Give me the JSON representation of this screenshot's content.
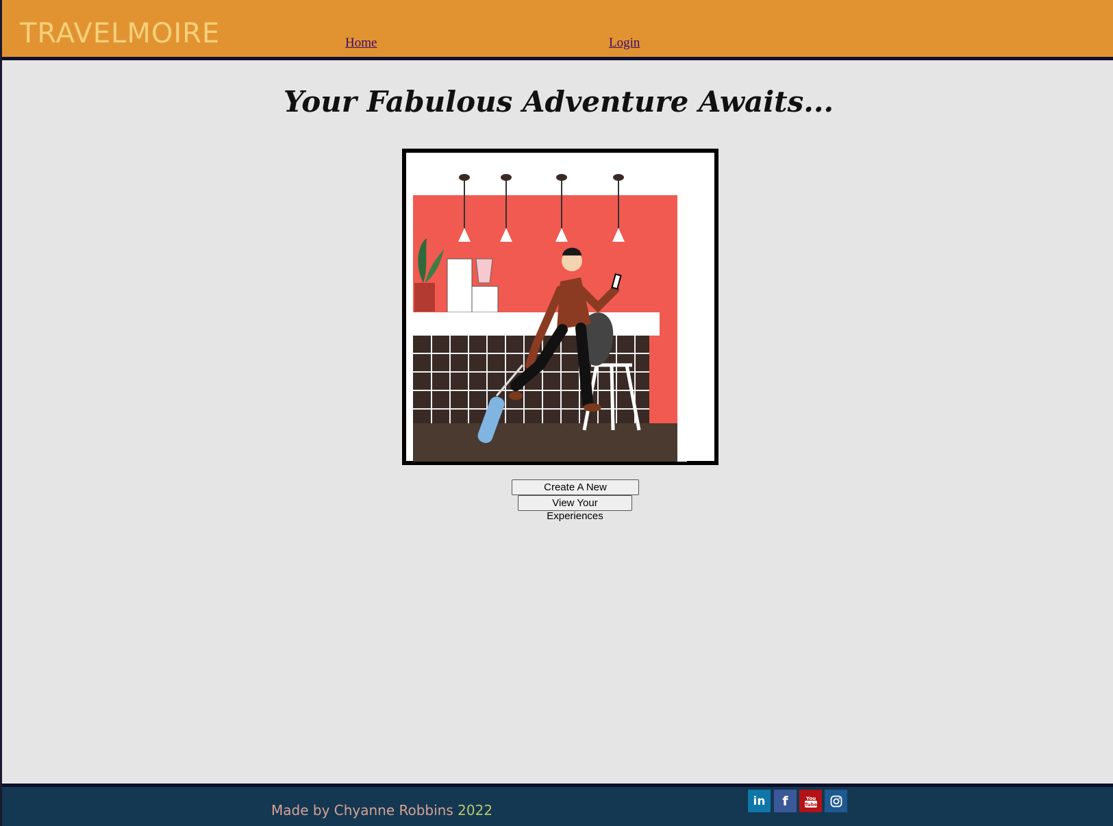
{
  "header": {
    "brand": "TRAVELMOIRE",
    "nav": {
      "home": "Home",
      "login": "Login"
    }
  },
  "main": {
    "title": "Your Fabulous Adventure Awaits...",
    "buttons": {
      "create": "Create A New Experience",
      "view": "View Your Experiences"
    }
  },
  "footer": {
    "credit_prefix": "Made by Chyanne Robbins",
    "credit_year": "2022",
    "social": {
      "linkedin": "in",
      "facebook": "f",
      "youtube": "You Tube",
      "instagram": "instagram-icon"
    }
  },
  "colors": {
    "header_bg": "#e29331",
    "brand": "#f6d07a",
    "page_bg": "#e5e5e5",
    "footer_bg": "#143752"
  }
}
